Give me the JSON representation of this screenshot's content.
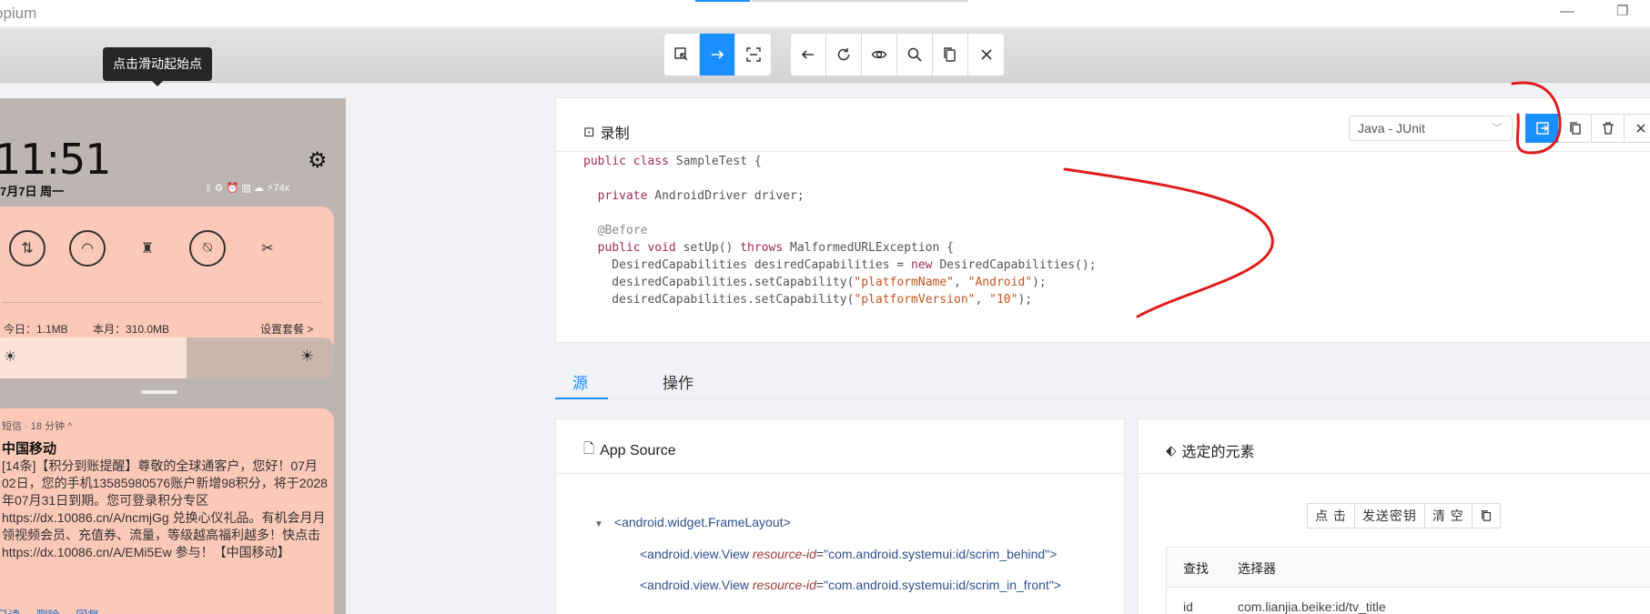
{
  "window": {
    "app_name": "opium",
    "minimize_glyph": "—",
    "maximize_glyph": "❐"
  },
  "toolbar": {
    "mode_buttons": [
      {
        "name": "select-elements-button",
        "icon": "select-arrow-icon"
      },
      {
        "name": "swipe-button",
        "icon": "swipe-arrow-icon",
        "active": true
      },
      {
        "name": "tap-coordinates-button",
        "icon": "crop-icon"
      }
    ],
    "action_buttons": [
      {
        "name": "back-button",
        "icon": "arrow-left-icon"
      },
      {
        "name": "refresh-button",
        "icon": "refresh-icon"
      },
      {
        "name": "record-button",
        "icon": "eye-icon"
      },
      {
        "name": "search-button",
        "icon": "search-icon"
      },
      {
        "name": "copy-xml-button",
        "icon": "copy-icon"
      },
      {
        "name": "quit-button",
        "icon": "close-icon"
      }
    ]
  },
  "tooltip": {
    "text": "点击滑动起始点"
  },
  "phone": {
    "time": "11:51",
    "date": "7月7日 周一",
    "status": "ᛒ ⚙ ⏰ ▥ ☁ ⚡74x",
    "usage_today": "今日：1.1MB",
    "usage_month": "本月：310.0MB",
    "plan_link": "设置套餐 >",
    "notification": {
      "app": "短信 · 18 分钟 ^",
      "title": "中国移动",
      "body": "[14条]【积分到账提醒】尊敬的全球通客户，您好！07月02日，您的手机13585980576账户新增98积分，将于2028年07月31日到期。您可登录积分专区https://dx.10086.cn/A/ncmjGg 兑换心仪礼品。有机会月月领视频会员、充值券、流量，等级越高福利越多！快点击 https://dx.10086.cn/A/EMi5Ew 参与！【中国移动】",
      "actions": [
        "已读",
        "删除",
        "回复"
      ]
    }
  },
  "recorder": {
    "title": "录制",
    "language_select": "Java - JUnit",
    "code_lines": [
      [
        {
          "t": "public class ",
          "c": "kw"
        },
        {
          "t": "SampleTest {",
          "c": ""
        }
      ],
      [],
      [
        {
          "t": "  private ",
          "c": "kw"
        },
        {
          "t": "AndroidDriver driver;",
          "c": ""
        }
      ],
      [],
      [
        {
          "t": "  @Before",
          "c": "ann"
        }
      ],
      [
        {
          "t": "  public void ",
          "c": "kw"
        },
        {
          "t": "setUp() ",
          "c": ""
        },
        {
          "t": "throws ",
          "c": "kw"
        },
        {
          "t": "MalformedURLException {",
          "c": ""
        }
      ],
      [
        {
          "t": "    DesiredCapabilities desiredCapabilities = ",
          "c": ""
        },
        {
          "t": "new ",
          "c": "kw"
        },
        {
          "t": "DesiredCapabilities();",
          "c": ""
        }
      ],
      [
        {
          "t": "    desiredCapabilities.setCapability(",
          "c": ""
        },
        {
          "t": "\"platformName\"",
          "c": "str"
        },
        {
          "t": ", ",
          "c": ""
        },
        {
          "t": "\"Android\"",
          "c": "str"
        },
        {
          "t": ");",
          "c": ""
        }
      ],
      [
        {
          "t": "    desiredCapabilities.setCapability(",
          "c": ""
        },
        {
          "t": "\"platformVersion\"",
          "c": "str"
        },
        {
          "t": ", ",
          "c": ""
        },
        {
          "t": "\"10\"",
          "c": "str"
        },
        {
          "t": ");",
          "c": ""
        }
      ]
    ]
  },
  "tabs": [
    {
      "label": "源",
      "active": true
    },
    {
      "label": "操作",
      "active": false
    }
  ],
  "app_source": {
    "title": "App Source",
    "nodes": [
      {
        "tag": "<android.widget.FrameLayout>",
        "indent": 0,
        "expanded": true
      },
      {
        "tag": "<android.view.View ",
        "attr": "resource-id",
        "value": "\"com.android.systemui:id/scrim_behind\"",
        "close": ">",
        "indent": 1
      },
      {
        "tag": "<android.view.View ",
        "attr": "resource-id",
        "value": "\"com.android.systemui:id/scrim_in_front\"",
        "close": ">",
        "indent": 1
      }
    ]
  },
  "selected_element": {
    "title": "选定的元素",
    "buttons": [
      "点 击",
      "发送密钥",
      "清 空"
    ],
    "table_headers": [
      "查找",
      "选择器"
    ],
    "rows": [
      {
        "find": "id",
        "selector": "com.lianjia.beike:id/tv_title"
      }
    ]
  },
  "colors": {
    "accent": "#1890ff",
    "annotation_red": "#e11b1b"
  }
}
